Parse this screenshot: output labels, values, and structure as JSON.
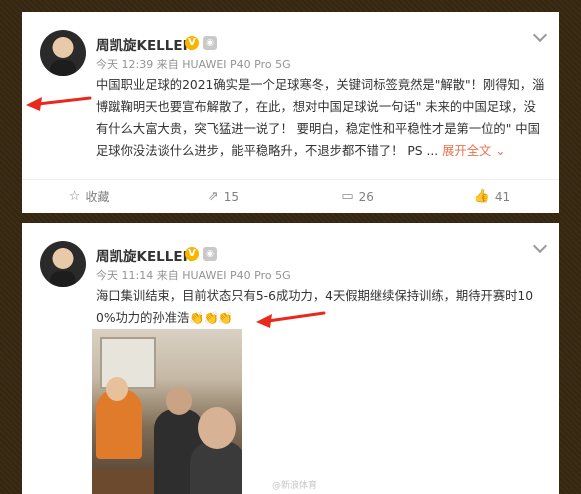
{
  "posts": [
    {
      "author": "周凯旋KELLER",
      "verified_badge": "V",
      "time": "今天 12:39",
      "source_prefix": "来自",
      "source": "HUAWEI P40 Pro 5G",
      "text": "中国职业足球的2021确实是一个足球寒冬，关键词标签竟然是\"解散\"！刚得知，淄博蹴鞠明天也要宣布解散了，在此，想对中国足球说一句话\" 未来的中国足球，没有什么大富大贵，突飞猛进一说了！ 要明白，稳定性和平稳性才是第一位的\" 中国足球你没法谈什么进步，能平稳略升，不退步都不错了！ PS  ...",
      "expand_label": "展开全文",
      "actions": [
        {
          "icon": "star-icon",
          "label": "收藏"
        },
        {
          "icon": "share-icon",
          "label": "15"
        },
        {
          "icon": "comment-icon",
          "label": "26"
        },
        {
          "icon": "thumbs-up-icon",
          "label": "41"
        }
      ]
    },
    {
      "author": "周凯旋KELLER",
      "verified_badge": "V",
      "time": "今天 11:14",
      "source_prefix": "来自",
      "source": "HUAWEI P40 Pro 5G",
      "text": "海口集训结束，目前状态只有5-6成功力，4天假期继续保持训练，期待开赛时100%功力的孙准浩",
      "emoji": "👏👏👏",
      "watermark": "@新浪体育"
    }
  ],
  "colors": {
    "background": "#3a2a14",
    "arrow": "#e8291c",
    "link": "#eb7350",
    "meta": "#939393"
  }
}
